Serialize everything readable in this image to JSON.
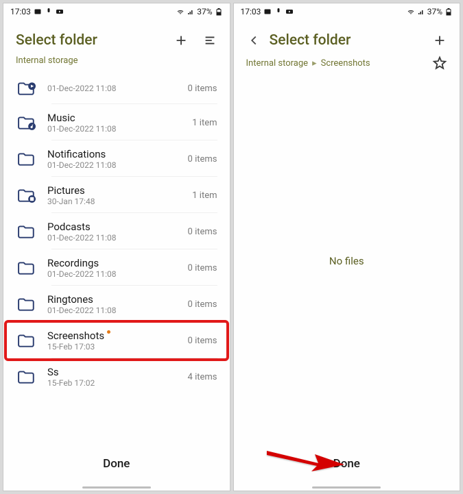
{
  "status": {
    "time": "17:03",
    "battery": "37%"
  },
  "left": {
    "title": "Select folder",
    "breadcrumb": "Internal storage",
    "footer": "Done",
    "rows": [
      {
        "name": "",
        "sub": "01-Dec-2022 11:08",
        "count": "0 items",
        "icon": "play"
      },
      {
        "name": "Music",
        "sub": "01-Dec-2022 11:08",
        "count": "1 item",
        "icon": "music"
      },
      {
        "name": "Notifications",
        "sub": "01-Dec-2022 11:08",
        "count": "0 items",
        "icon": "plain"
      },
      {
        "name": "Pictures",
        "sub": "30-Jan 17:48",
        "count": "1 item",
        "icon": "picture"
      },
      {
        "name": "Podcasts",
        "sub": "01-Dec-2022 11:08",
        "count": "0 items",
        "icon": "plain"
      },
      {
        "name": "Recordings",
        "sub": "01-Dec-2022 11:08",
        "count": "0 items",
        "icon": "plain"
      },
      {
        "name": "Ringtones",
        "sub": "01-Dec-2022 11:08",
        "count": "0 items",
        "icon": "plain"
      },
      {
        "name": "Screenshots",
        "sub": "15-Feb 17:03",
        "count": "0 items",
        "icon": "plain",
        "new": true,
        "highlight": true
      },
      {
        "name": "Ss",
        "sub": "15-Feb 17:02",
        "count": "4 items",
        "icon": "plain"
      }
    ]
  },
  "right": {
    "title": "Select folder",
    "breadcrumb_root": "Internal storage",
    "breadcrumb_cur": "Screenshots",
    "empty": "No files",
    "footer": "Done"
  }
}
